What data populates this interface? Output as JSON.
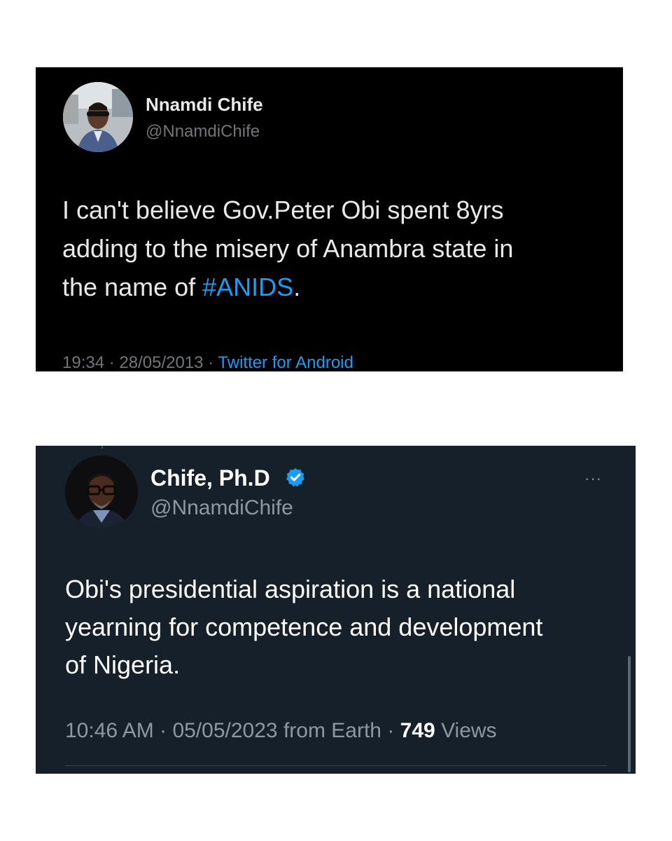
{
  "tweet_old": {
    "display_name": "Nnamdi Chife",
    "handle": "@NnamdiChife",
    "text_line1": "I can't believe Gov.Peter Obi spent 8yrs",
    "text_line2": "adding to the misery of Anambra state in",
    "text_line3_prefix": "the name of ",
    "hashtag": "#ANIDS",
    "text_line3_suffix": ".",
    "time": "19:34",
    "date": "28/05/2013",
    "separator": " · ",
    "source": "Twitter for Android",
    "avatar_icon": "profile-photo-man-sunglasses"
  },
  "tweet_new": {
    "display_name": "Chife, Ph.D",
    "verified_icon": "verified-badge-icon",
    "handle": "@NnamdiChife",
    "more_icon": "more-dots-icon",
    "more_glyph": "···",
    "text_line1": "Obi's presidential aspiration is a national",
    "text_line2": "yearning for competence and development",
    "text_line3": "of Nigeria.",
    "time": "10:46 AM",
    "date": "05/05/2023",
    "separator": " · ",
    "location_text": "from Earth",
    "views_count": "749",
    "views_label": "Views",
    "avatar_icon": "profile-photo-man-glasses"
  },
  "colors": {
    "accent": "#1d9bf0",
    "dim_background": "#15202b",
    "black_background": "#000000"
  }
}
